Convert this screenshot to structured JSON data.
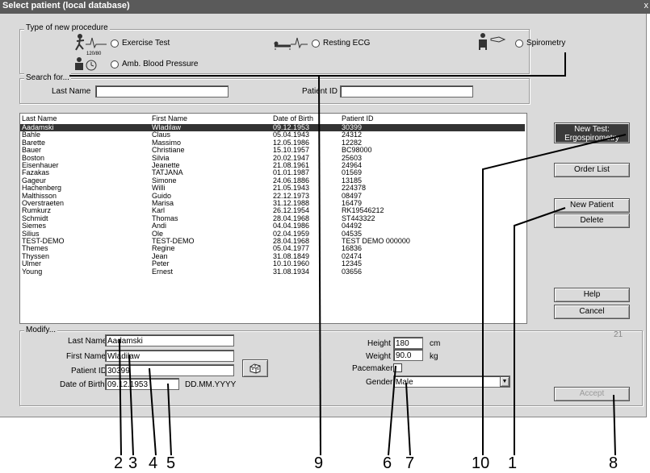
{
  "window": {
    "title": "Select patient (local database)",
    "close": "x"
  },
  "procedure": {
    "legend": "Type of new procedure",
    "options": [
      "Exercise Test",
      "Resting ECG",
      "Spirometry",
      "Amb. Blood Pressure"
    ],
    "bp_icon_text": "120/80"
  },
  "search": {
    "legend": "Search for...",
    "last_name_label": "Last Name",
    "patient_id_label": "Patient ID"
  },
  "list": {
    "columns": [
      "Last Name",
      "First Name",
      "Date of Birth",
      "Patient ID"
    ],
    "rows": [
      [
        "Aadamski",
        "Wladilaw",
        "09.12.1953",
        "30399"
      ],
      [
        "Bahle",
        "Claus",
        "05.04.1943",
        "24312"
      ],
      [
        "Barette",
        "Massimo",
        "12.05.1986",
        "12282"
      ],
      [
        "Bauer",
        "Christiane",
        "15.10.1957",
        "BC98000"
      ],
      [
        "Boston",
        "Silvia",
        "20.02.1947",
        "25603"
      ],
      [
        "Eisenhauer",
        "Jeanette",
        "21.08.1961",
        "24964"
      ],
      [
        "Fazakas",
        "TATJANA",
        "01.01.1987",
        "01569"
      ],
      [
        "Gageur",
        "Simone",
        "24.06.1886",
        "13185"
      ],
      [
        "Hachenberg",
        "Willi",
        "21.05.1943",
        "224378"
      ],
      [
        "Malthisson",
        "Guido",
        "22.12.1973",
        "08497"
      ],
      [
        "Overstraeten",
        "Marisa",
        "31.12.1988",
        "16479"
      ],
      [
        "Rumkurz",
        "Karl",
        "26.12.1954",
        "RK19546212"
      ],
      [
        "Schmidt",
        "Thomas",
        "28.04.1968",
        "ST443322"
      ],
      [
        "Siemes",
        "Andi",
        "04.04.1986",
        "04492"
      ],
      [
        "Silius",
        "Ole",
        "02.04.1959",
        "04535"
      ],
      [
        "TEST-DEMO",
        "TEST-DEMO",
        "28.04.1968",
        "TEST DEMO 000000"
      ],
      [
        "Themes",
        "Regine",
        "05.04.1977",
        "16836"
      ],
      [
        "Thyssen",
        "Jean",
        "31.08.1849",
        "02474"
      ],
      [
        "Ulmer",
        "Peter",
        "10.10.1960",
        "12345"
      ],
      [
        "Young",
        "Ernest",
        "31.08.1934",
        "03656"
      ]
    ]
  },
  "buttons": {
    "new_test_line1": "New Test:",
    "new_test_line2": "Ergospirometry",
    "order_list": "Order List",
    "new_patient": "New Patient",
    "delete": "Delete",
    "help": "Help",
    "cancel": "Cancel",
    "accept": "Accept"
  },
  "modify": {
    "legend": "Modify...",
    "last_name_label": "Last Name",
    "last_name": "Aadamski",
    "first_name_label": "First Name",
    "first_name": "Wladilaw",
    "patient_id_label": "Patient ID",
    "patient_id": "30399",
    "dob_label": "Date of Birth",
    "dob": "09.12.1953",
    "dob_format": "DD.MM.YYYY",
    "height_label": "Height",
    "height": "180",
    "height_unit": "cm",
    "weight_label": "Weight",
    "weight": "90.0",
    "weight_unit": "kg",
    "pacemaker_label": "Pacemaker",
    "gender_label": "Gender",
    "gender": "Male",
    "count": "21"
  },
  "callouts": [
    "2",
    "3",
    "4",
    "5",
    "9",
    "6",
    "7",
    "10",
    "1",
    "8"
  ]
}
